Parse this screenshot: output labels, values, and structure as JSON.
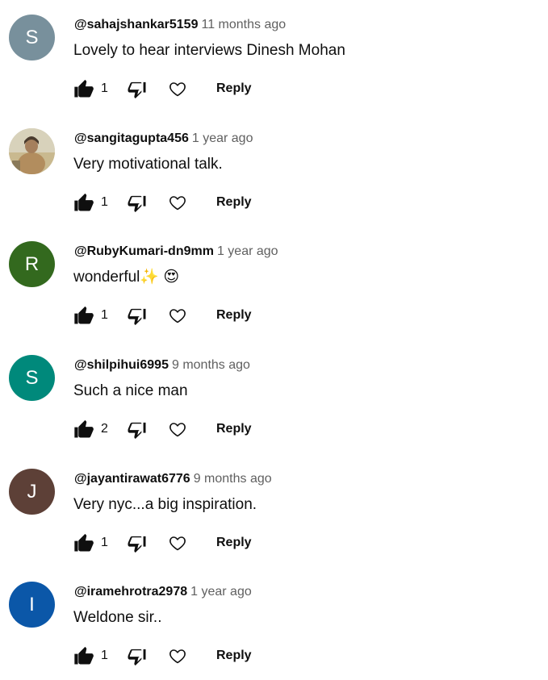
{
  "comments": [
    {
      "initial": "S",
      "avatar_color": "#78909c",
      "handle": "@sahajshankar5159",
      "time": "11 months ago",
      "text": "Lovely to hear  interviews Dinesh Mohan",
      "likes": "1",
      "reply_label": "Reply"
    },
    {
      "initial": "",
      "avatar_color": "#cfc9b2",
      "handle": "@sangitagupta456",
      "time": "1 year ago",
      "text": "Very motivational talk.",
      "likes": "1",
      "reply_label": "Reply"
    },
    {
      "initial": "R",
      "avatar_color": "#33691e",
      "handle": "@RubyKumari-dn9mm",
      "time": "1 year ago",
      "text": "wonderful✨ 😍",
      "likes": "1",
      "reply_label": "Reply"
    },
    {
      "initial": "S",
      "avatar_color": "#00897b",
      "handle": "@shilpihui6995",
      "time": "9 months ago",
      "text": "Such a nice man",
      "likes": "2",
      "reply_label": "Reply"
    },
    {
      "initial": "J",
      "avatar_color": "#5d4037",
      "handle": "@jayantirawat6776",
      "time": "9 months ago",
      "text": "Very nyc...a big inspiration.",
      "likes": "1",
      "reply_label": "Reply"
    },
    {
      "initial": "I",
      "avatar_color": "#0b57a8",
      "handle": "@iramehrotra2978",
      "time": "1 year ago",
      "text": "Weldone sir..",
      "likes": "1",
      "reply_label": "Reply"
    }
  ]
}
